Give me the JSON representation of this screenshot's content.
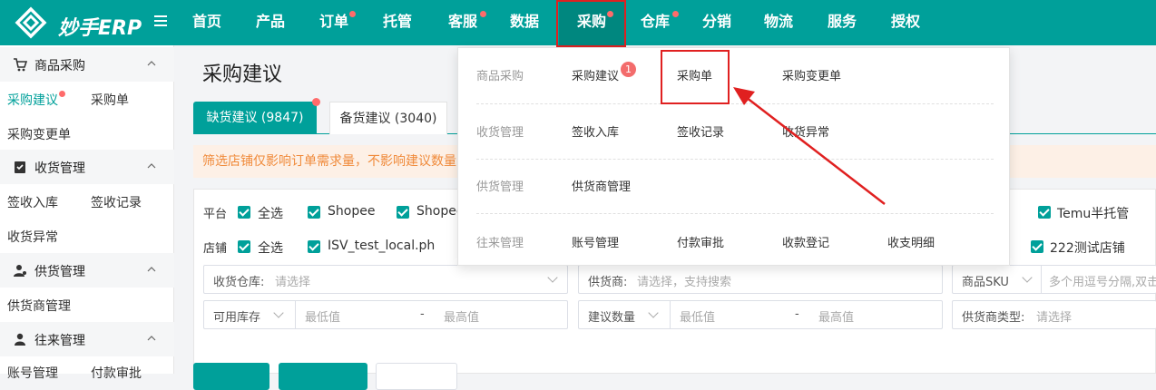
{
  "brand": {
    "name": "妙手ERP"
  },
  "nav": [
    {
      "label": "首页",
      "dot": false
    },
    {
      "label": "产品",
      "dot": false
    },
    {
      "label": "订单",
      "dot": true
    },
    {
      "label": "托管",
      "dot": false
    },
    {
      "label": "客服",
      "dot": true
    },
    {
      "label": "数据",
      "dot": false
    },
    {
      "label": "采购",
      "dot": true,
      "active": true
    },
    {
      "label": "仓库",
      "dot": true
    },
    {
      "label": "分销",
      "dot": false
    },
    {
      "label": "物流",
      "dot": false
    },
    {
      "label": "服务",
      "dot": false
    },
    {
      "label": "授权",
      "dot": false
    }
  ],
  "sidebar": {
    "groups": [
      {
        "label": "商品采购",
        "icon": "cart-icon",
        "links": [
          "采购建议",
          "采购单",
          "采购变更单"
        ]
      },
      {
        "label": "收货管理",
        "icon": "checklist-icon",
        "links": [
          "签收入库",
          "签收记录",
          "收货异常"
        ]
      },
      {
        "label": "供货管理",
        "icon": "supplier-icon",
        "links": [
          "供货商管理"
        ]
      },
      {
        "label": "往来管理",
        "icon": "user-icon",
        "links": [
          "账号管理",
          "付款审批"
        ]
      }
    ]
  },
  "main": {
    "title": "采购建议",
    "tabs": [
      {
        "label": "缺货建议 (9847)",
        "active": true
      },
      {
        "label": "备货建议 (3040)",
        "active": false
      }
    ],
    "notice": "筛选店铺仅影响订单需求量，不影响建议数量",
    "platform_label": "平台",
    "platforms": [
      "全选",
      "Shopee",
      "Shopee",
      "Temu半托管"
    ],
    "shop_label": "店铺",
    "shops": [
      "全选",
      "ISV_test_local.ph",
      "222测试店铺"
    ],
    "fields": {
      "warehouse": {
        "label": "收货仓库:",
        "placeholder": "请选择"
      },
      "supplier": {
        "label": "供货商:",
        "placeholder": "请选择，支持搜索"
      },
      "sku": {
        "label": "商品SKU",
        "placeholder": "多个用逗号分隔,双击"
      },
      "stock": {
        "label": "可用库存",
        "min": "最低值",
        "dash": "-",
        "max": "最高值"
      },
      "suggest": {
        "label": "建议数量",
        "min": "最低值",
        "dash": "-",
        "max": "最高值"
      },
      "supplier_type": {
        "label": "供货商类型:",
        "placeholder": "请选择"
      }
    }
  },
  "dropdown": {
    "rows": [
      {
        "category": "商品采购",
        "items": [
          "采购建议",
          "采购单",
          "采购变更单"
        ],
        "badge": "1"
      },
      {
        "category": "收货管理",
        "items": [
          "签收入库",
          "签收记录",
          "收货异常"
        ]
      },
      {
        "category": "供货管理",
        "items": [
          "供货商管理"
        ]
      },
      {
        "category": "往来管理",
        "items": [
          "账号管理",
          "付款审批",
          "收款登记",
          "收支明细"
        ]
      }
    ]
  },
  "colors": {
    "brand": "#00a09a",
    "brand_dark": "#00877f",
    "highlight": "#e02020",
    "notice_bg": "#fdf0e6",
    "notice_text": "#f08a3a"
  }
}
